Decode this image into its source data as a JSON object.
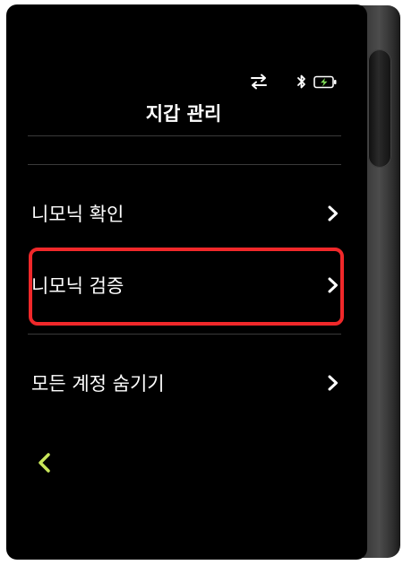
{
  "header": {
    "title": "지갑 관리",
    "status_icons": [
      "swap-arrows-icon",
      "bluetooth-icon",
      "battery-charging-icon"
    ]
  },
  "menu": {
    "items": [
      {
        "label": "니모닉 확인",
        "icon": "chevron-right-icon"
      },
      {
        "label": "니모닉 검증",
        "icon": "chevron-right-icon",
        "highlighted": true
      },
      {
        "label": "모든 계정 숨기기",
        "icon": "chevron-right-icon"
      }
    ]
  },
  "footer": {
    "back_icon": "chevron-left-icon"
  },
  "colors": {
    "screen_background": "#000000",
    "text": "#ffffff",
    "divider": "#3a3a3a",
    "highlight": "#f0282a",
    "back_accent": "#c8e65a",
    "battery_accent": "#7ed957"
  }
}
